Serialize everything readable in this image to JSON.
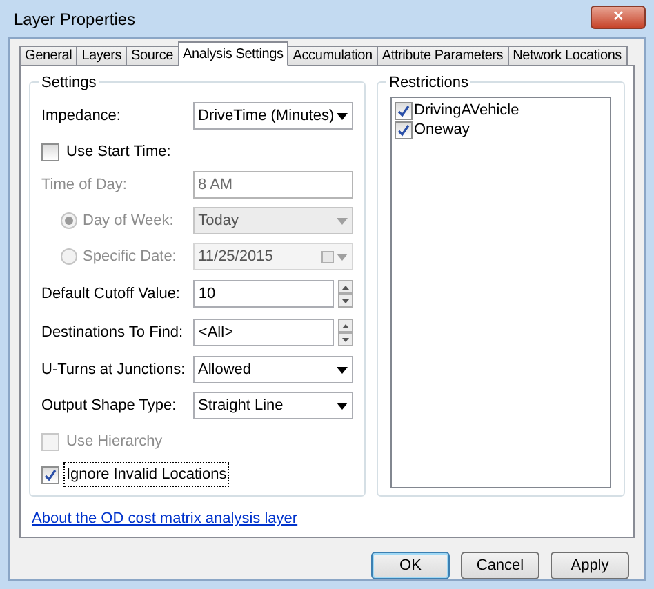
{
  "window": {
    "title": "Layer Properties",
    "close": "✕"
  },
  "tabs": [
    {
      "label": "General",
      "selected": false
    },
    {
      "label": "Layers",
      "selected": false
    },
    {
      "label": "Source",
      "selected": false
    },
    {
      "label": "Analysis Settings",
      "selected": true
    },
    {
      "label": "Accumulation",
      "selected": false
    },
    {
      "label": "Attribute Parameters",
      "selected": false
    },
    {
      "label": "Network Locations",
      "selected": false
    }
  ],
  "settings": {
    "title": "Settings",
    "rows": [
      {
        "kind": "dropdown",
        "label": "Impedance:",
        "value": "DriveTime (Minutes)",
        "disabled": false
      },
      {
        "kind": "checkbox",
        "label": "Use Start Time:",
        "checked": false,
        "disabled": false
      },
      {
        "kind": "text",
        "label": "Time of Day:",
        "value": "8 AM",
        "disabled": true
      },
      {
        "kind": "radio-dropdown",
        "label": "Day of Week:",
        "value": "Today",
        "selected": true,
        "disabled": true
      },
      {
        "kind": "radio-date",
        "label": "Specific Date:",
        "value": "11/25/2015",
        "selected": false,
        "disabled": true
      },
      {
        "kind": "spinner",
        "label": "Default Cutoff Value:",
        "value": "10",
        "disabled": false
      },
      {
        "kind": "spinner",
        "label": "Destinations To Find:",
        "value": "<All>",
        "disabled": false
      },
      {
        "kind": "dropdown",
        "label": "U-Turns at Junctions:",
        "value": "Allowed",
        "disabled": false
      },
      {
        "kind": "dropdown",
        "label": "Output Shape Type:",
        "value": "Straight Line",
        "disabled": false
      },
      {
        "kind": "checkbox",
        "label": "Use Hierarchy",
        "checked": false,
        "disabled": true
      },
      {
        "kind": "checkbox",
        "label": "Ignore Invalid Locations",
        "checked": true,
        "disabled": false,
        "focused": true
      }
    ]
  },
  "restrictions": {
    "title": "Restrictions",
    "items": [
      {
        "label": "DrivingAVehicle",
        "checked": true
      },
      {
        "label": "Oneway",
        "checked": true
      }
    ]
  },
  "link": "About the OD cost matrix analysis layer",
  "buttons": [
    {
      "label": "OK",
      "default": true
    },
    {
      "label": "Cancel",
      "default": false
    },
    {
      "label": "Apply",
      "default": false
    }
  ]
}
